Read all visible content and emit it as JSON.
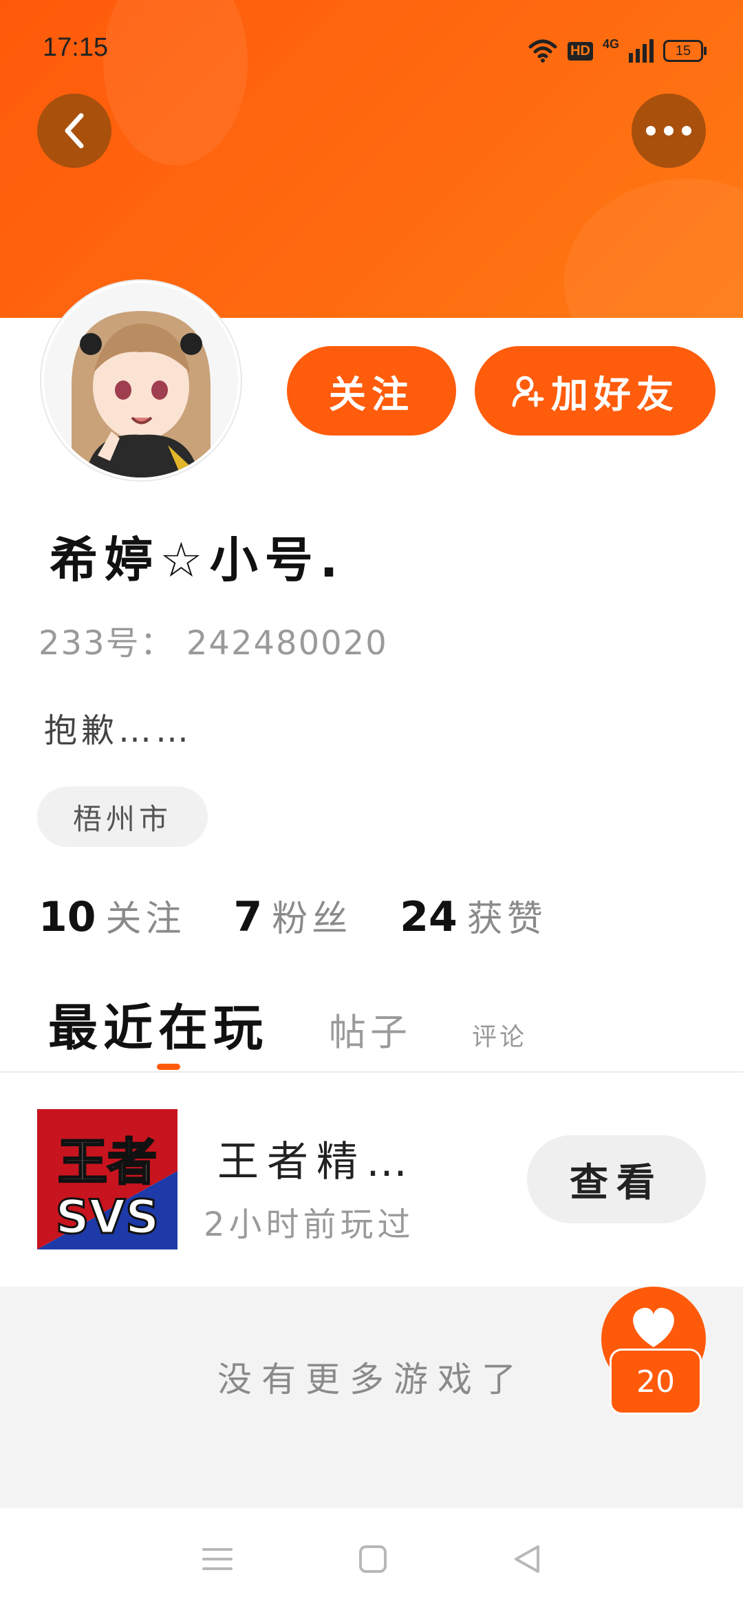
{
  "status_bar": {
    "time": "17:15",
    "hd": "HD",
    "network": "4G",
    "battery": "15"
  },
  "header": {
    "back_icon": "chevron-left-icon",
    "more_icon": "more-dots-icon",
    "colors": {
      "bg": "#ff6a10"
    }
  },
  "actions": {
    "follow_label": "关注",
    "add_friend_label": "加好友"
  },
  "profile": {
    "name": "希婷☆小号.",
    "uid": "233号： 242480020",
    "bio": "抱歉……",
    "location": "梧州市"
  },
  "stats": [
    {
      "num": "10",
      "label": "关注"
    },
    {
      "num": "7",
      "label": "粉丝"
    },
    {
      "num": "24",
      "label": "获赞"
    }
  ],
  "tabs": {
    "recent": "最近在玩",
    "posts": "帖子",
    "comments": "评论"
  },
  "game": {
    "icon_text_top": "王者",
    "icon_text_bottom": "SVS",
    "title": "王者精…",
    "subtitle": "2小时前玩过",
    "view_label": "查看"
  },
  "empty_text": "没有更多游戏了",
  "like_badge": {
    "count": "20",
    "icon": "heart-icon"
  },
  "navbar": {
    "icons": [
      "menu-icon",
      "home-square-icon",
      "back-triangle-icon"
    ]
  },
  "colors": {
    "accent": "#ff5c0c"
  }
}
